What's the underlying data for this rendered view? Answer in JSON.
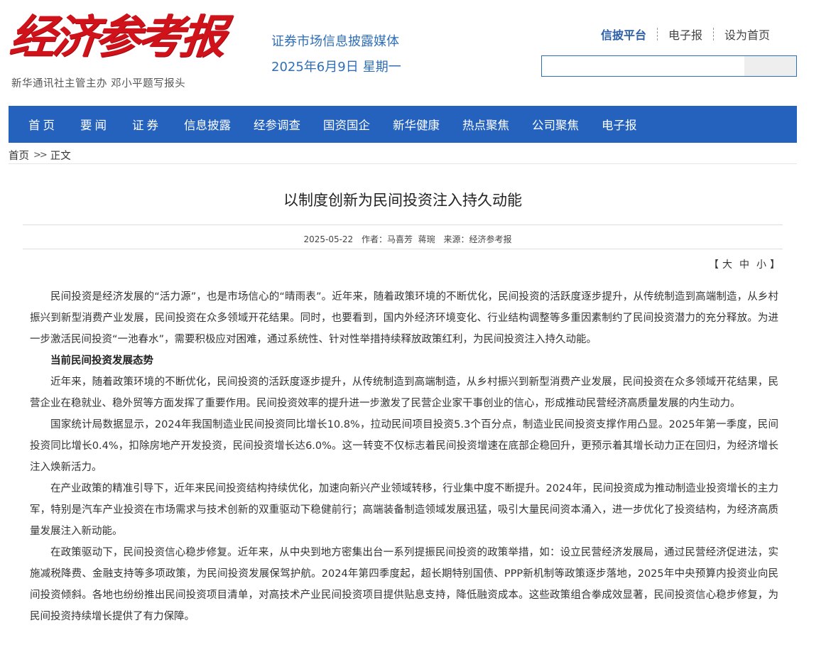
{
  "header": {
    "logo_text": "经济参考报",
    "logo_sub": "新华通讯社主管主办  邓小平题写报头",
    "tagline": "证券市场信息披露媒体",
    "date": "2025年6月9日",
    "weekday": "星期一",
    "links": [
      "信披平台",
      "电子报",
      "设为首页"
    ],
    "search": {
      "value": "",
      "placeholder": ""
    }
  },
  "nav": [
    "首页",
    "要闻",
    "证券",
    "信息披露",
    "经参调查",
    "国资国企",
    "新华健康",
    "热点聚焦",
    "公司聚焦",
    "电子报"
  ],
  "breadcrumb": {
    "home": "首页",
    "arrow": ">>",
    "current": "正文"
  },
  "article": {
    "title": "以制度创新为民间投资注入持久动能",
    "date": "2025-05-22",
    "author_label": "作者：",
    "authors": "马喜芳  蒋琬",
    "source_label": "来源：",
    "source": "经济参考报",
    "font_size_controls": {
      "open": "【",
      "large": "大",
      "medium": "中",
      "small": "小",
      "close": "】"
    },
    "paragraphs": [
      {
        "type": "text",
        "text": "民间投资是经济发展的“活力源”，也是市场信心的“晴雨表”。近年来，随着政策环境的不断优化，民间投资的活跃度逐步提升，从传统制造到高端制造，从乡村振兴到新型消费产业发展，民间投资在众多领域开花结果。同时，也要看到，国内外经济环境变化、行业结构调整等多重因素制约了民间投资潜力的充分释放。为进一步激活民间投资“一池春水”，需要积极应对困难，通过系统性、针对性举措持续释放政策红利，为民间投资注入持久动能。"
      },
      {
        "type": "heading",
        "text": "当前民间投资发展态势"
      },
      {
        "type": "text",
        "text": "近年来，随着政策环境的不断优化，民间投资的活跃度逐步提升，从传统制造到高端制造，从乡村振兴到新型消费产业发展，民间投资在众多领域开花结果，民营企业在稳就业、稳外贸等方面发挥了重要作用。民间投资效率的提升进一步激发了民营企业家干事创业的信心，形成推动民营经济高质量发展的内生动力。"
      },
      {
        "type": "text",
        "text": "国家统计局数据显示，2024年我国制造业民间投资同比增长10.8%，拉动民间项目投资5.3个百分点，制造业民间投资支撑作用凸显。2025年第一季度，民间投资同比增长0.4%，扣除房地产开发投资，民间投资增长达6.0%。这一转变不仅标志着民间投资增速在底部企稳回升，更预示着其增长动力正在回归，为经济增长注入焕新活力。"
      },
      {
        "type": "text",
        "text": "在产业政策的精准引导下，近年来民间投资结构持续优化，加速向新兴产业领域转移，行业集中度不断提升。2024年，民间投资成为推动制造业投资增长的主力军，特别是汽车产业投资在市场需求与技术创新的双重驱动下稳健前行；高端装备制造领域发展迅猛，吸引大量民间资本涌入，进一步优化了投资结构，为经济高质量发展注入新动能。"
      },
      {
        "type": "text",
        "text": "在政策驱动下，民间投资信心稳步修复。近年来，从中央到地方密集出台一系列提振民间投资的政策举措，如：设立民营经济发展局，通过民营经济促进法，实施减税降费、金融支持等多项政策，为民间投资发展保驾护航。2024年第四季度起，超长期特别国债、PPP新机制等政策逐步落地，2025年中央预算内投资业向民间投资倾斜。各地也纷纷推出民间投资项目清单，对高技术产业民间投资项目提供贴息支持，降低融资成本。这些政策组合拳成效显著，民间投资信心稳步修复，为民间投资持续增长提供了有力保障。"
      }
    ]
  }
}
